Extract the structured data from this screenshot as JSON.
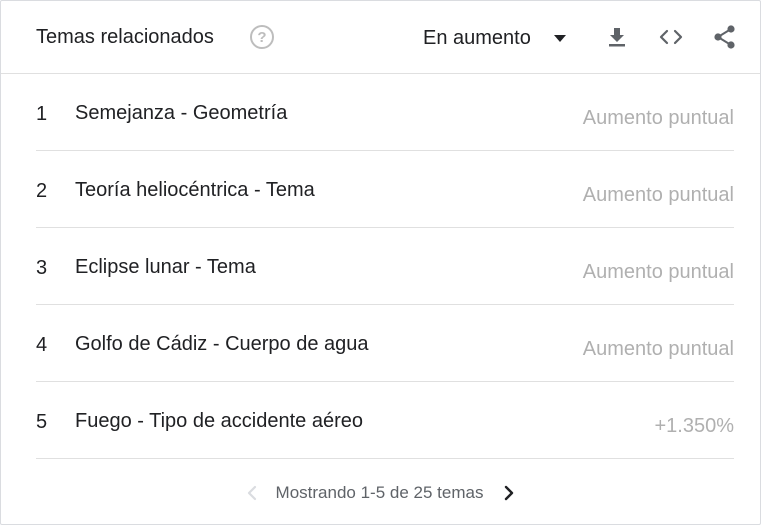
{
  "header": {
    "title": "Temas relacionados",
    "sort_label": "En aumento"
  },
  "icons": {
    "help": "help-circle-icon",
    "caret": "caret-down-icon",
    "download": "download-icon",
    "embed": "embed-code-icon",
    "share": "share-icon",
    "prev": "chevron-left-icon",
    "next": "chevron-right-icon"
  },
  "colors": {
    "text": "#202124",
    "muted_value": "#b0b0b0",
    "icon": "#5f6368",
    "divider": "#e0e0e0"
  },
  "rows": [
    {
      "rank": "1",
      "name": "Semejanza - Geometría",
      "value": "Aumento puntual"
    },
    {
      "rank": "2",
      "name": "Teoría heliocéntrica - Tema",
      "value": "Aumento puntual"
    },
    {
      "rank": "3",
      "name": "Eclipse lunar - Tema",
      "value": "Aumento puntual"
    },
    {
      "rank": "4",
      "name": "Golfo de Cádiz - Cuerpo de agua",
      "value": "Aumento puntual"
    },
    {
      "rank": "5",
      "name": "Fuego - Tipo de accidente aéreo",
      "value": "+1.350%"
    }
  ],
  "pager": {
    "text": "Mostrando 1-5 de 25 temas"
  }
}
